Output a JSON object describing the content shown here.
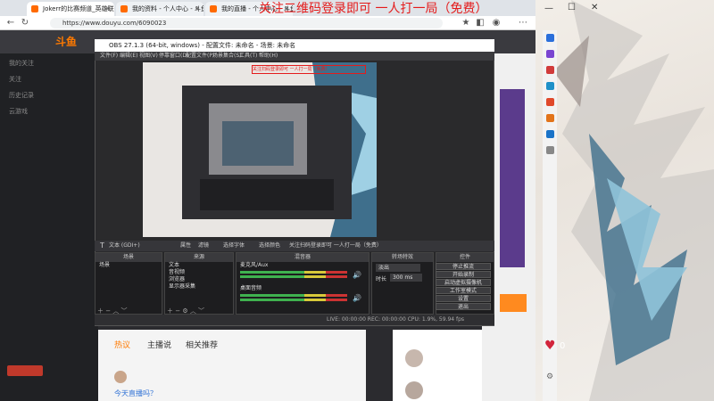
{
  "browser": {
    "tabs": [
      {
        "label": "Jokerr的比赛频道_英雄联盟直播_斗..."
      },
      {
        "label": "我的资料 - 个人中心 - 斗鱼"
      },
      {
        "label": "我的直播 - 个人中心 - 斗鱼"
      }
    ],
    "url": "https://www.douyu.com/6090023"
  },
  "banner": "关注二维码登录即可 一人打一局（免费）",
  "douyu": {
    "logo": "斗鱼",
    "sidebar": [
      "我的关注",
      "关注",
      "历史记录",
      "云游戏"
    ],
    "content_tabs": [
      "热议",
      "主播说",
      "相关推荐"
    ],
    "question": "今天直播吗？"
  },
  "obs": {
    "title": "OBS 27.1.3 (64-bit, windows) - 配置文件: 未命名 - 场景: 未命名",
    "menu": [
      "文件(F)",
      "编辑(E)",
      "视图(V)",
      "停靠窗口(D)",
      "配置文件(P)",
      "场景集合(S)",
      "工具(T)",
      "帮助(H)"
    ],
    "source_text": "文本 (GDI+)",
    "source_buttons": [
      "属性",
      "滤镜",
      "选择字体",
      "选择颜色"
    ],
    "marquee_text": "关注扫码登录即可 一人打一局（免费）",
    "docks": {
      "scenes": {
        "title": "场景",
        "items": [
          "场景"
        ]
      },
      "sources": {
        "title": "来源",
        "items": [
          "文本",
          "音视频",
          "浏览器",
          "显示器采集"
        ]
      },
      "mixer": {
        "title": "混音器",
        "tracks": [
          "麦克风/Aux",
          "桌面音频"
        ]
      },
      "transitions": {
        "title": "转场特效",
        "type": "淡出",
        "duration_label": "时长",
        "duration_value": "300 ms"
      },
      "controls": {
        "title": "控件",
        "buttons": [
          "停止推流",
          "开始录制",
          "启动虚拟摄像机",
          "工作室模式",
          "设置",
          "退出"
        ]
      }
    },
    "status": "LIVE: 00:00:00   REC: 00:00:00   CPU: 1.9%, 59.94 fps"
  },
  "desktop": {
    "heart_count": "0"
  }
}
